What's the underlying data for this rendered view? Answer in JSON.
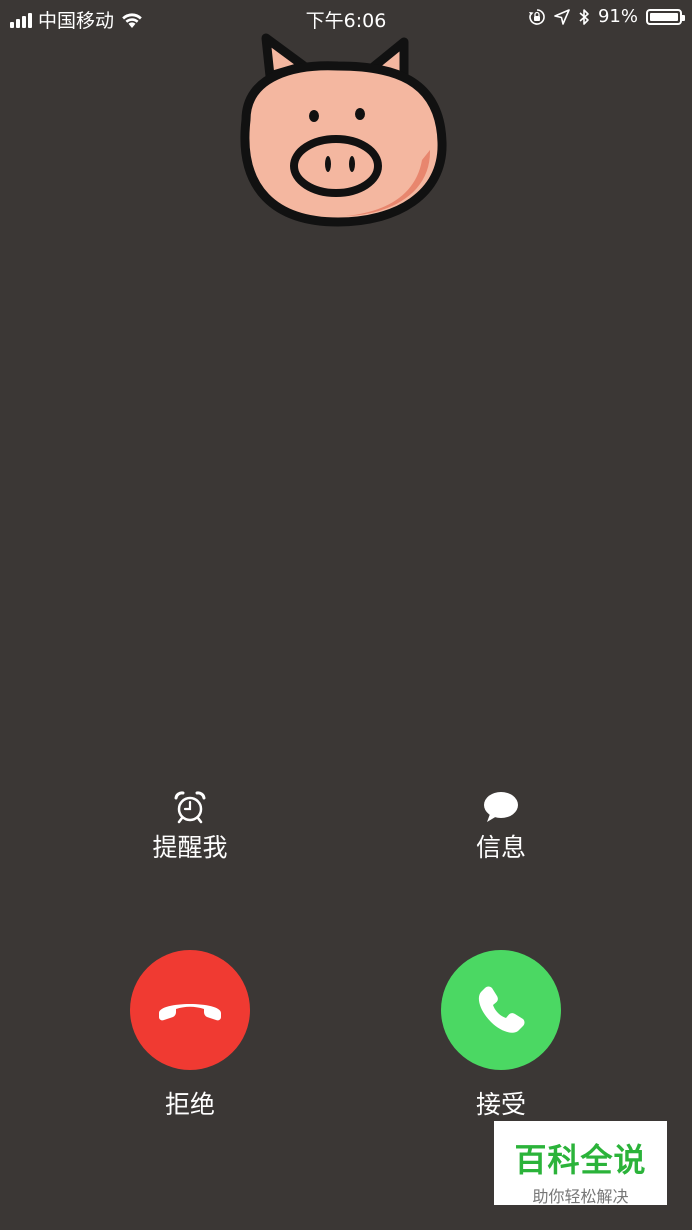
{
  "status_bar": {
    "carrier": "中国移动",
    "time": "下午6:06",
    "battery_percent": "91%",
    "battery_level": 0.91,
    "icons": [
      "signal-icon",
      "wifi-icon",
      "orientation-lock-icon",
      "location-arrow-icon",
      "bluetooth-icon",
      "battery-icon"
    ]
  },
  "caller": {
    "avatar_icon": "pig-face-icon"
  },
  "actions": {
    "remind_label": "提醒我",
    "remind_icon": "alarm-clock-icon",
    "message_label": "信息",
    "message_icon": "speech-bubble-icon"
  },
  "call_buttons": {
    "decline_label": "拒绝",
    "decline_color": "#f03a32",
    "accept_label": "接受",
    "accept_color": "#4bd863"
  },
  "watermark": {
    "title": "百科全说",
    "subtitle": "助你轻松解决"
  }
}
